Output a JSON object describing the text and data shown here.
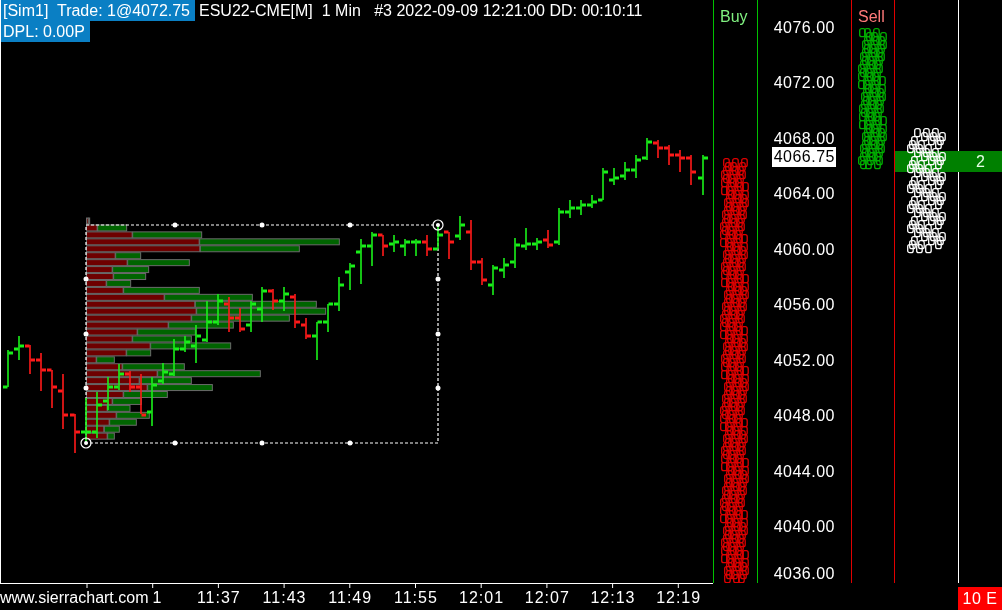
{
  "header": {
    "account_label": "[Sim1]  Trade: 1@4072.75",
    "chart_info": "ESU22-CME[M]  1 Min   #3 2022-09-09 12:21:00 DD: 00:10:11",
    "dpl_label": "DPL: 0.00P"
  },
  "buy_column": {
    "title": "Buy"
  },
  "price_axis": {
    "labels": [
      "4076.00",
      "4072.00",
      "4068.00",
      "4064.00",
      "4060.00",
      "4056.00",
      "4052.00",
      "4048.00",
      "4044.00",
      "4040.00",
      "4036.00"
    ],
    "current_price": "4066.75"
  },
  "sell_column": {
    "title": "Sell"
  },
  "highlight_row": {
    "value": "2"
  },
  "bottom_bar": {
    "site_text": "www.sierrachart.com",
    "cut_time_label": "1",
    "time_labels": [
      "11:37",
      "11:43",
      "11:49",
      "11:55",
      "12:01",
      "12:07",
      "12:13",
      "12:19"
    ],
    "status_badge": "10 E"
  }
}
